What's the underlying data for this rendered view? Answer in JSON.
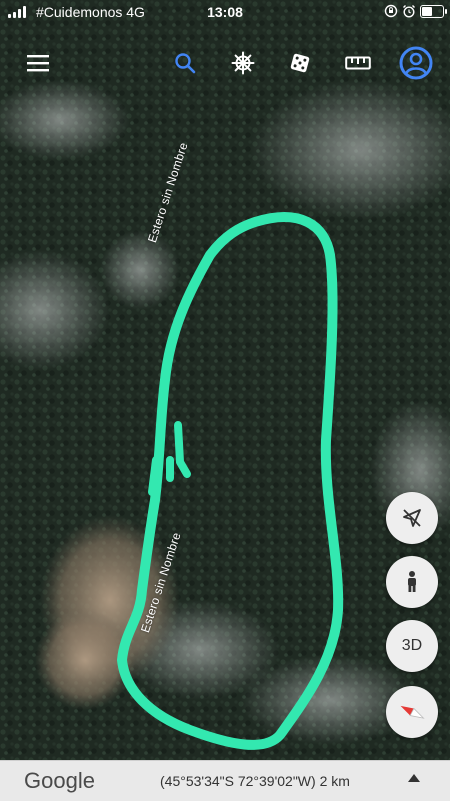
{
  "status_bar": {
    "carrier": "#Cuidemonos  4G",
    "time": "13:08"
  },
  "toolbar": {
    "menu_icon": "hamburger-menu-icon",
    "search_icon": "search-icon",
    "voyager_icon": "ship-wheel-icon",
    "random_icon": "dice-icon",
    "measure_icon": "ruler-icon",
    "account_icon": "account-circle-icon",
    "accent_color": "#4285f4"
  },
  "map": {
    "labels": [
      "Estero sin Nombre",
      "Estero sin Nombre"
    ],
    "drawing_color": "#33e8b0"
  },
  "controls": {
    "location_off_icon": "location-off-icon",
    "pegman_icon": "pegman-icon",
    "view_3d_label": "3D",
    "compass_icon": "compass-icon"
  },
  "bottom_bar": {
    "logo": "Google",
    "coordinates": "(45°53'34\"S 72°39'02\"W) 2 km",
    "expand_icon": "caret-up-icon"
  }
}
